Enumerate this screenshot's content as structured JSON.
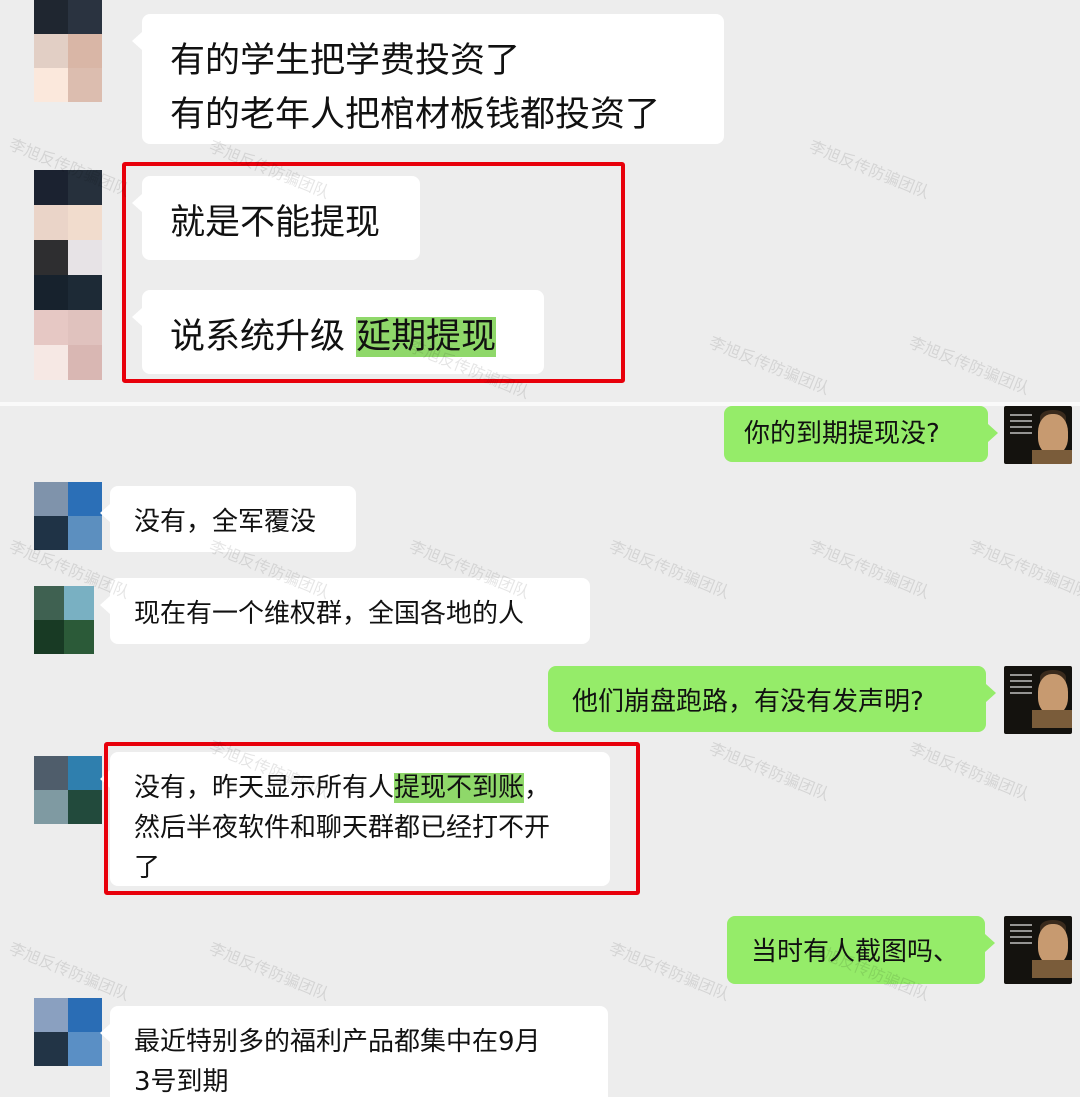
{
  "top_chat": {
    "messages": [
      {
        "lines": "有的学生把学费投资了\n有的老年人把棺材板钱都投资了"
      },
      {
        "text": "就是不能提现"
      },
      {
        "text_plain": "说系统升级 ",
        "text_highlight": "延期提现"
      }
    ]
  },
  "bottom_chat": {
    "messages": [
      {
        "text": "你的到期提现没?"
      },
      {
        "text": "没有，全军覆没"
      },
      {
        "text": "现在有一个维权群，全国各地的人"
      },
      {
        "text": "他们崩盘跑路，有没有发声明?"
      },
      {
        "before": "没有，昨天显示所有人",
        "highlight": "提现不到账",
        "after": "，\n然后半夜软件和聊天群都已经打不开\n了"
      },
      {
        "text": "当时有人截图吗、"
      },
      {
        "lines": "最近特别多的福利产品都集中在9月\n3号到期"
      }
    ]
  },
  "watermark": {
    "text": "李旭反传防骗团队"
  },
  "colors": {
    "background": "#ededed",
    "incoming_bubble": "#ffffff",
    "outgoing_bubble": "#95ec69",
    "text_highlight": "#8fd86a",
    "annotation_box": "#e8000b"
  },
  "icons": {
    "avatar_mosaic": "pixelated-avatar",
    "avatar_photo": "user-photo-avatar"
  }
}
